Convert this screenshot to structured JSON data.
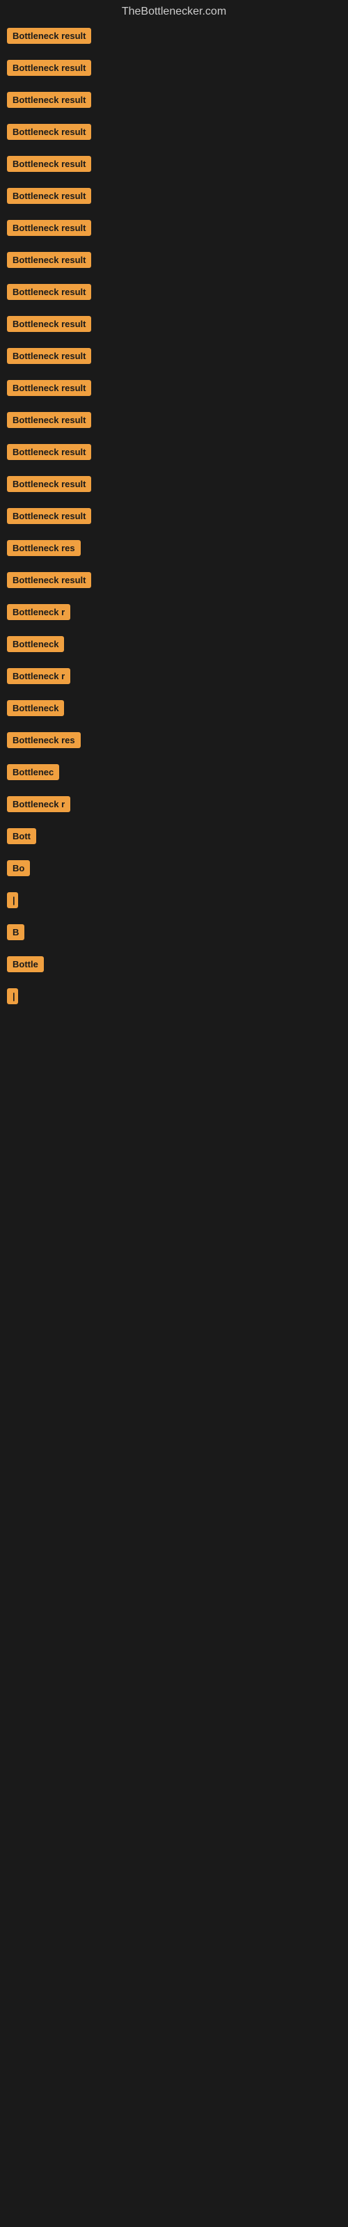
{
  "site": {
    "title": "TheBottlenecker.com"
  },
  "items": [
    {
      "id": 1,
      "label": "Bottleneck result"
    },
    {
      "id": 2,
      "label": "Bottleneck result"
    },
    {
      "id": 3,
      "label": "Bottleneck result"
    },
    {
      "id": 4,
      "label": "Bottleneck result"
    },
    {
      "id": 5,
      "label": "Bottleneck result"
    },
    {
      "id": 6,
      "label": "Bottleneck result"
    },
    {
      "id": 7,
      "label": "Bottleneck result"
    },
    {
      "id": 8,
      "label": "Bottleneck result"
    },
    {
      "id": 9,
      "label": "Bottleneck result"
    },
    {
      "id": 10,
      "label": "Bottleneck result"
    },
    {
      "id": 11,
      "label": "Bottleneck result"
    },
    {
      "id": 12,
      "label": "Bottleneck result"
    },
    {
      "id": 13,
      "label": "Bottleneck result"
    },
    {
      "id": 14,
      "label": "Bottleneck result"
    },
    {
      "id": 15,
      "label": "Bottleneck result"
    },
    {
      "id": 16,
      "label": "Bottleneck result"
    },
    {
      "id": 17,
      "label": "Bottleneck res"
    },
    {
      "id": 18,
      "label": "Bottleneck result"
    },
    {
      "id": 19,
      "label": "Bottleneck r"
    },
    {
      "id": 20,
      "label": "Bottleneck"
    },
    {
      "id": 21,
      "label": "Bottleneck r"
    },
    {
      "id": 22,
      "label": "Bottleneck"
    },
    {
      "id": 23,
      "label": "Bottleneck res"
    },
    {
      "id": 24,
      "label": "Bottlenec"
    },
    {
      "id": 25,
      "label": "Bottleneck r"
    },
    {
      "id": 26,
      "label": "Bott"
    },
    {
      "id": 27,
      "label": "Bo"
    },
    {
      "id": 28,
      "label": "|"
    },
    {
      "id": 29,
      "label": "B"
    },
    {
      "id": 30,
      "label": "Bottle"
    },
    {
      "id": 31,
      "label": "|"
    }
  ]
}
